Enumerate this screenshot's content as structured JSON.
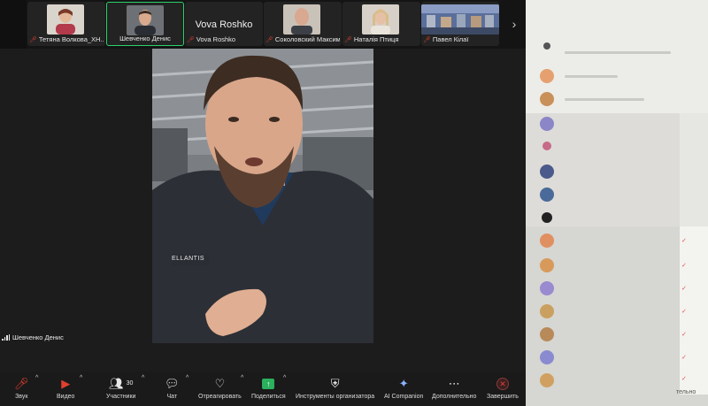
{
  "participants": [
    {
      "name": "Тетяна Волкова_ХН...",
      "muted": true,
      "active": false
    },
    {
      "name": "Шевченко Денис",
      "muted": false,
      "active": true
    },
    {
      "name": "Vova Roshko",
      "display_name": "Vova Roshko",
      "muted": true,
      "active": false
    },
    {
      "name": "Соколовский Максим",
      "muted": true,
      "active": false
    },
    {
      "name": "Наталія Птиця",
      "muted": true,
      "active": false
    },
    {
      "name": "Павел Кілаї",
      "muted": true,
      "active": false
    }
  ],
  "speaker": {
    "name": "Шевченко Денис",
    "shirt_logo": "ELLANTIS"
  },
  "toolbar": {
    "audio": "Звук",
    "video": "Видео",
    "participants": "Участники",
    "participants_count": "30",
    "chat": "Чат",
    "react": "Отреагировать",
    "share": "Поделиться",
    "host_tools": "Инструменты организатора",
    "ai_companion": "AI Companion",
    "more": "Дополнительно",
    "end": "Завершить"
  },
  "side_window": {
    "footer_fragment": "тельно"
  },
  "colors": {
    "active_border": "#2bd26a",
    "muted_red": "#e0402f",
    "share_green": "#2bb05d",
    "toolbar_bg": "#1a1a1a"
  },
  "icons": [
    "mic-muted-icon",
    "video-off-icon",
    "participants-icon",
    "chat-icon",
    "heart-icon",
    "share-screen-icon",
    "shield-icon",
    "sparkle-icon",
    "more-icon",
    "end-call-icon"
  ]
}
